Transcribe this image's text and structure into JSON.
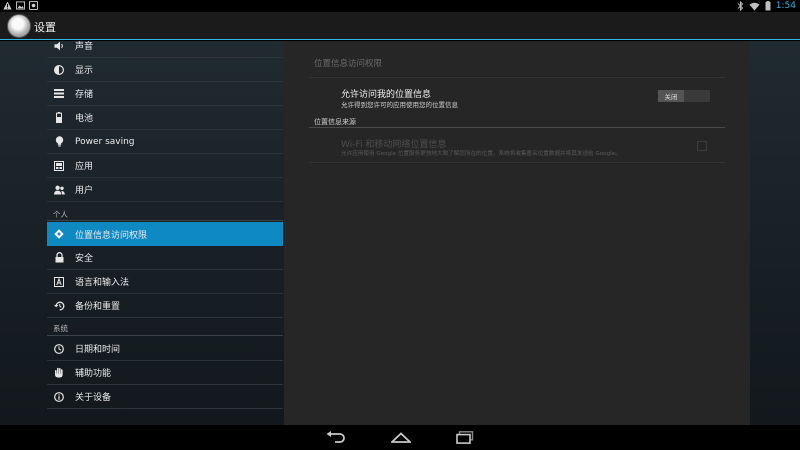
{
  "status_bar": {
    "time": "1:54",
    "accent": "#33b5e5"
  },
  "action_bar": {
    "title": "设置"
  },
  "sidebar": {
    "items": [
      {
        "label": "声音",
        "icon": "volume-icon"
      },
      {
        "label": "显示",
        "icon": "brightness-icon"
      },
      {
        "label": "存储",
        "icon": "storage-icon"
      },
      {
        "label": "电池",
        "icon": "battery-icon"
      },
      {
        "label": "Power saving",
        "icon": "lightbulb-icon"
      },
      {
        "label": "应用",
        "icon": "apps-icon"
      },
      {
        "label": "用户",
        "icon": "user-icon"
      }
    ],
    "personal_header": "个人",
    "personal_items": [
      {
        "label": "位置信息访问权限",
        "icon": "location-icon",
        "selected": true
      },
      {
        "label": "安全",
        "icon": "lock-icon"
      },
      {
        "label": "语言和输入法",
        "icon": "language-icon"
      },
      {
        "label": "备份和重置",
        "icon": "backup-icon"
      }
    ],
    "system_header": "系统",
    "system_items": [
      {
        "label": "日期和时间",
        "icon": "clock-icon"
      },
      {
        "label": "辅助功能",
        "icon": "hand-icon"
      },
      {
        "label": "关于设备",
        "icon": "info-icon"
      }
    ],
    "selected_color": "#0f89c1"
  },
  "detail": {
    "title": "位置信息访问权限",
    "access": {
      "title": "允许访问我的位置信息",
      "summary": "允许得到您许可的应用使用您的位置信息",
      "switch_label": "关闭",
      "enabled": false
    },
    "sources_header": "位置信息来源",
    "wifi_source": {
      "title": "Wi-Fi 和移动网络位置信息",
      "summary": "允许应用使用 Google 位置服务更快地大致了解您所在的位置。系统将收集匿名位置数据并将其发送给 Google。",
      "checked": false
    }
  }
}
